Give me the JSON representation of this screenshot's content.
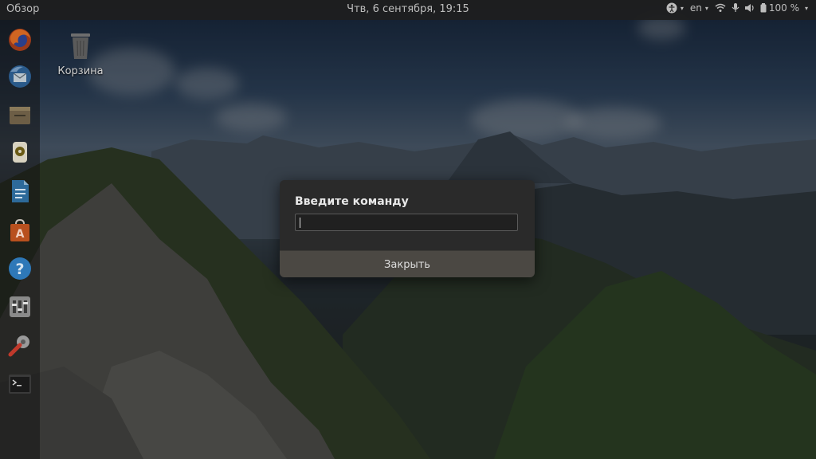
{
  "topbar": {
    "activities_label": "Обзор",
    "clock": "Чтв, 6 сентября, 19:15",
    "keyboard_layout": "en",
    "battery_percent": "100 %"
  },
  "dock": {
    "items": [
      {
        "name": "firefox-icon"
      },
      {
        "name": "thunderbird-icon"
      },
      {
        "name": "files-icon"
      },
      {
        "name": "rhythmbox-icon"
      },
      {
        "name": "libreoffice-writer-icon"
      },
      {
        "name": "software-center-icon"
      },
      {
        "name": "help-icon"
      },
      {
        "name": "settings-icon"
      },
      {
        "name": "software-updater-icon"
      },
      {
        "name": "terminal-icon"
      }
    ]
  },
  "desktop": {
    "trash_label": "Корзина"
  },
  "dialog": {
    "title": "Введите команду",
    "input_value": "",
    "close_label": "Закрыть"
  },
  "colors": {
    "dialog_bg": "#2a2a2a",
    "dialog_button_bg": "#4b4843",
    "topbar_bg": "#1e1e1e"
  }
}
